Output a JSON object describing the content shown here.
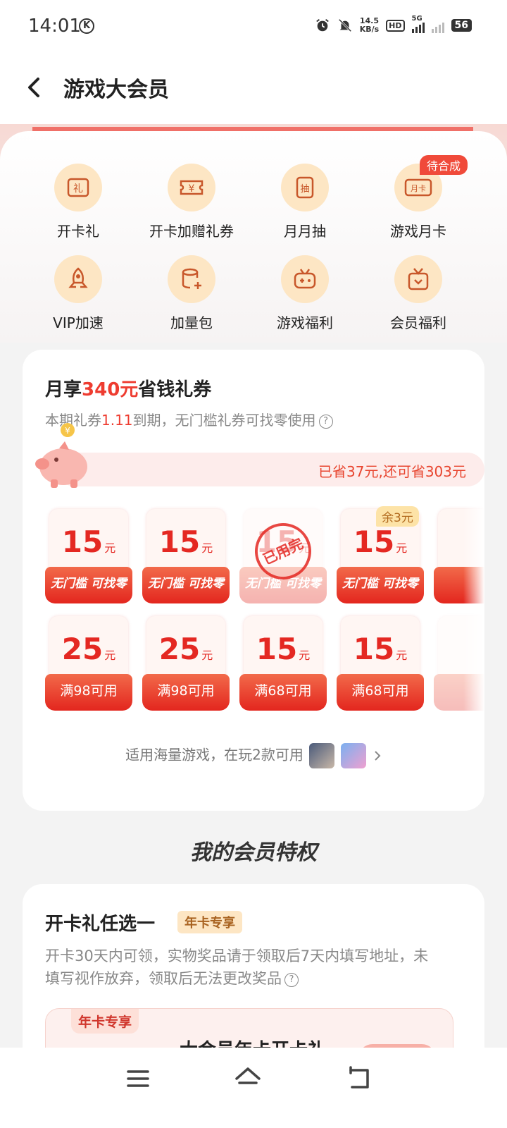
{
  "status_bar": {
    "time": "14:01",
    "k_label": "K",
    "speed_top": "14.5",
    "speed_bottom": "KB/s",
    "hd_label": "HD",
    "network_label": "5G",
    "battery": "56"
  },
  "nav": {
    "title": "游戏大会员",
    "back_icon": "chevron-left-icon"
  },
  "menu": {
    "pending_badge": "待合成",
    "items": [
      {
        "label": "开卡礼",
        "icon": "gift-card-icon",
        "glyph": "礼"
      },
      {
        "label": "开卡加赠礼券",
        "icon": "yen-ticket-icon",
        "glyph": "¥"
      },
      {
        "label": "月月抽",
        "icon": "draw-icon",
        "glyph": "抽"
      },
      {
        "label": "游戏月卡",
        "icon": "month-card-icon",
        "glyph": "月卡"
      },
      {
        "label": "VIP加速",
        "icon": "rocket-icon",
        "glyph": ""
      },
      {
        "label": "加量包",
        "icon": "data-pack-icon",
        "glyph": ""
      },
      {
        "label": "游戏福利",
        "icon": "gamepad-icon",
        "glyph": ""
      },
      {
        "label": "会员福利",
        "icon": "gift-box-icon",
        "glyph": ""
      }
    ]
  },
  "coupons": {
    "title_prefix": "月享",
    "title_amount": "340元",
    "title_suffix": "省钱礼券",
    "subtitle_prefix": "本期礼券",
    "subtitle_date": "1.11",
    "subtitle_suffix": "到期，无门槛礼券可找零使用",
    "savings_text": "已省37元,还可省303元",
    "unit": "元",
    "used_stamp": "已用完",
    "remain_badge": "余3元",
    "row1": [
      {
        "amount": "15",
        "label": "无门槛 可找零",
        "state": "available"
      },
      {
        "amount": "15",
        "label": "无门槛 可找零",
        "state": "available"
      },
      {
        "amount": "15",
        "label": "无门槛 可找零",
        "state": "used"
      },
      {
        "amount": "15",
        "label": "无门槛 可找零",
        "state": "partial"
      }
    ],
    "row2": [
      {
        "amount": "25",
        "label": "满98可用"
      },
      {
        "amount": "25",
        "label": "满98可用"
      },
      {
        "amount": "15",
        "label": "满68可用"
      },
      {
        "amount": "15",
        "label": "满68可用"
      }
    ],
    "footer_text": "适用海量游戏，在玩2款可用"
  },
  "privileges": {
    "section_title": "我的会员特权",
    "card_title": "开卡礼任选一",
    "card_tag": "年卡专享",
    "card_desc": "开卡30天内可领，实物奖品请于领取后7天内填写地址，未填写视作放弃，领取后无法更改奖品",
    "gift_tag": "年卡专享",
    "gift_title": "大会员年卡开卡礼"
  },
  "colors": {
    "accent": "#e42822",
    "badge": "#f04a3a",
    "icon_bg": "#fde6c4"
  }
}
